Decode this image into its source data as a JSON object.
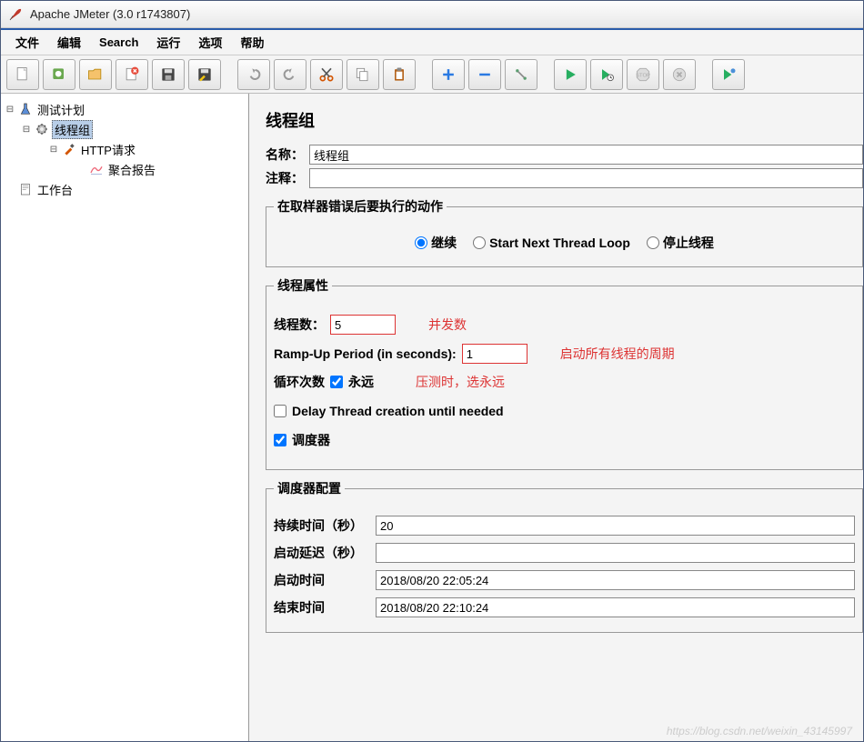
{
  "title": "Apache JMeter (3.0 r1743807)",
  "menu": [
    "文件",
    "编辑",
    "Search",
    "运行",
    "选项",
    "帮助"
  ],
  "tree": {
    "testplan": "测试计划",
    "threadgroup": "线程组",
    "http": "HTTP请求",
    "agg": "聚合报告",
    "workbench": "工作台"
  },
  "panel": {
    "title": "线程组",
    "name_label": "名称：",
    "name_value": "线程组",
    "comment_label": "注释："
  },
  "onerror": {
    "legend": "在取样器错误后要执行的动作",
    "opts": [
      "继续",
      "Start Next Thread Loop",
      "停止线程"
    ],
    "selected": 0
  },
  "props": {
    "legend": "线程属性",
    "threads_label": "线程数：",
    "threads_value": "5",
    "threads_note": "并发数",
    "ramp_label": "Ramp-Up Period (in seconds):",
    "ramp_value": "1",
    "ramp_note": "启动所有线程的周期",
    "loop_label": "循环次数",
    "forever_label": "永远",
    "loop_note": "压测时，选永远",
    "delay_label": "Delay Thread creation until needed",
    "scheduler_label": "调度器"
  },
  "sched": {
    "legend": "调度器配置",
    "duration_label": "持续时间（秒）",
    "duration_value": "20",
    "delay_label": "启动延迟（秒）",
    "delay_value": "",
    "start_label": "启动时间",
    "start_value": "2018/08/20 22:05:24",
    "end_label": "结束时间",
    "end_value": "2018/08/20 22:10:24"
  },
  "watermark": "https://blog.csdn.net/weixin_43145997"
}
